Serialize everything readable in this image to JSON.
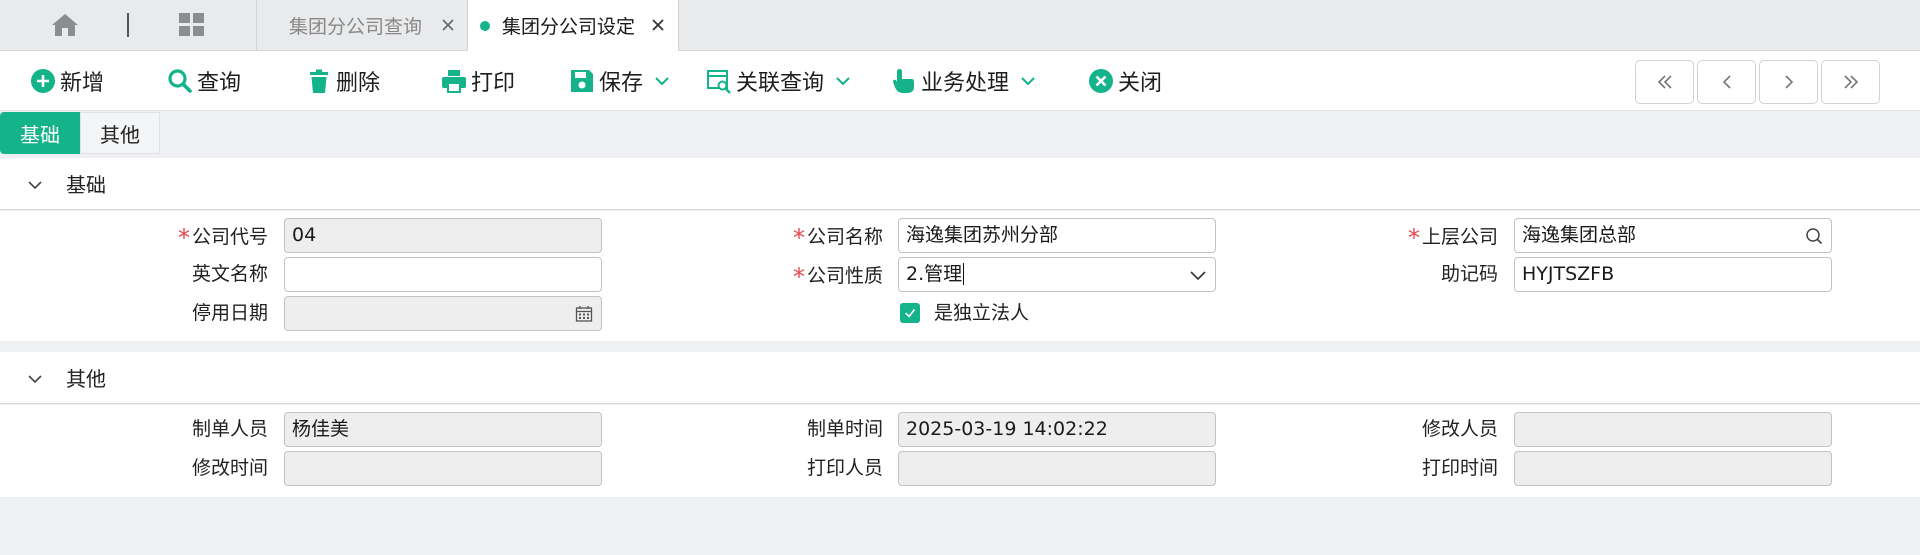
{
  "tabs": [
    {
      "label": "集团分公司查询",
      "active": false
    },
    {
      "label": "集团分公司设定",
      "active": true
    }
  ],
  "toolbar": {
    "add": "新增",
    "query": "查询",
    "delete": "删除",
    "print": "打印",
    "save": "保存",
    "related_query": "关联查询",
    "business": "业务处理",
    "close": "关闭"
  },
  "subtabs": [
    "基础",
    "其他"
  ],
  "sections": {
    "basic": {
      "title": "基础",
      "fields": {
        "company_code": {
          "label": "公司代号",
          "value": "04",
          "required": true
        },
        "company_name": {
          "label": "公司名称",
          "value": "海逸集团苏州分部",
          "required": true
        },
        "parent_company": {
          "label": "上层公司",
          "value": "海逸集团总部",
          "required": true
        },
        "english_name": {
          "label": "英文名称",
          "value": "",
          "required": false
        },
        "company_nature": {
          "label": "公司性质",
          "value": "2.管理",
          "required": true
        },
        "mnemonic": {
          "label": "助记码",
          "value": "HYJTSZFB",
          "required": false
        },
        "disable_date": {
          "label": "停用日期",
          "value": "",
          "required": false
        },
        "independent_legal": {
          "label": "是独立法人",
          "checked": true
        }
      }
    },
    "other": {
      "title": "其他",
      "fields": {
        "creator": {
          "label": "制单人员",
          "value": "杨佳美"
        },
        "create_time": {
          "label": "制单时间",
          "value": "2025-03-19 14:02:22"
        },
        "modifier": {
          "label": "修改人员",
          "value": ""
        },
        "modify_time": {
          "label": "修改时间",
          "value": ""
        },
        "printer": {
          "label": "打印人员",
          "value": ""
        },
        "print_time": {
          "label": "打印时间",
          "value": ""
        }
      }
    }
  },
  "colors": {
    "accent": "#14b38a",
    "required": "#e5484d",
    "readonly_bg": "#eeeeee"
  }
}
